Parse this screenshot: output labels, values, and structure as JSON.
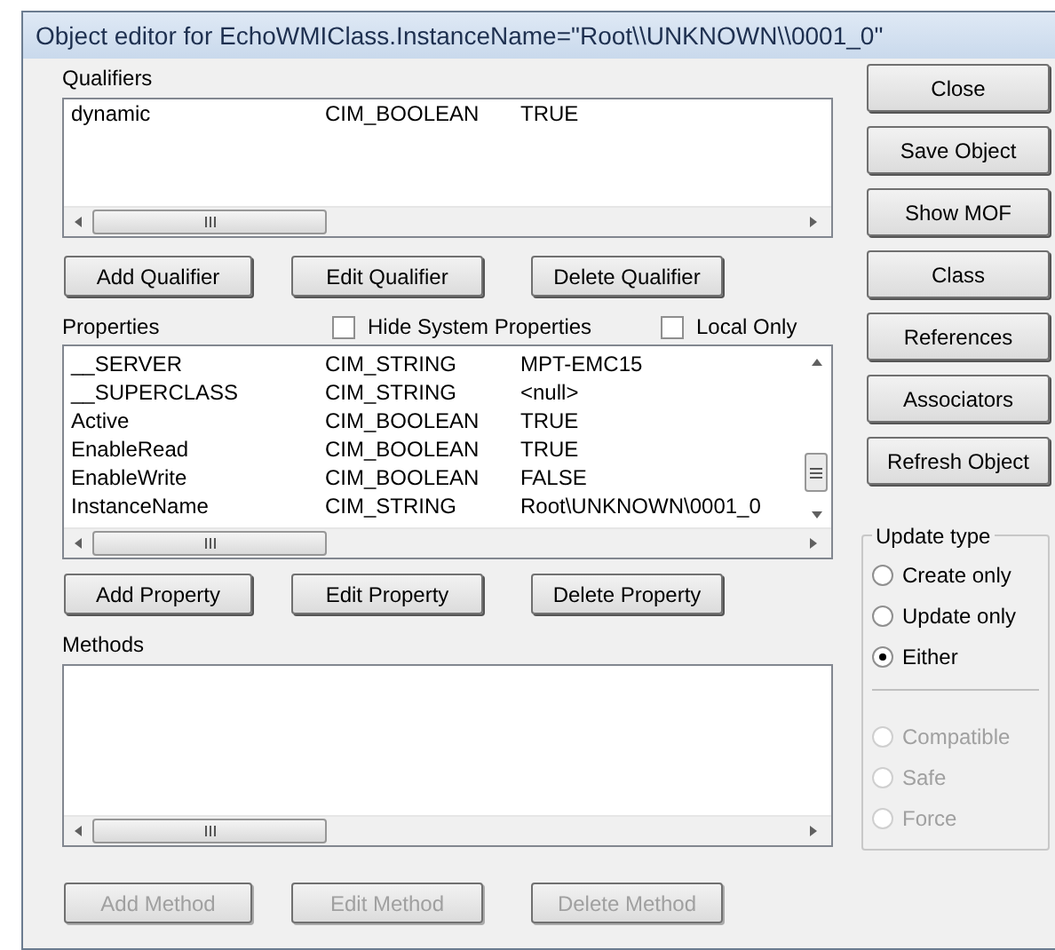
{
  "window": {
    "title": "Object editor for EchoWMIClass.InstanceName=\"Root\\\\UNKNOWN\\\\0001_0\""
  },
  "qualifiers": {
    "label": "Qualifiers",
    "rows": [
      {
        "name": "dynamic",
        "type": "CIM_BOOLEAN",
        "value": "TRUE"
      }
    ],
    "buttons": [
      {
        "label": "Add Qualifier",
        "disabled": false
      },
      {
        "label": "Edit Qualifier",
        "disabled": false
      },
      {
        "label": "Delete Qualifier",
        "disabled": false
      }
    ]
  },
  "properties": {
    "label": "Properties",
    "options": [
      {
        "label": "Hide System Properties",
        "checked": false
      },
      {
        "label": "Local Only",
        "checked": false
      }
    ],
    "rows": [
      {
        "name": "__SERVER",
        "type": "CIM_STRING",
        "value": "MPT-EMC15"
      },
      {
        "name": "__SUPERCLASS",
        "type": "CIM_STRING",
        "value": "<null>"
      },
      {
        "name": "Active",
        "type": "CIM_BOOLEAN",
        "value": "TRUE"
      },
      {
        "name": "EnableRead",
        "type": "CIM_BOOLEAN",
        "value": "TRUE"
      },
      {
        "name": "EnableWrite",
        "type": "CIM_BOOLEAN",
        "value": "FALSE"
      },
      {
        "name": "InstanceName",
        "type": "CIM_STRING",
        "value": "Root\\UNKNOWN\\0001_0"
      }
    ],
    "buttons": [
      {
        "label": "Add Property",
        "disabled": false
      },
      {
        "label": "Edit Property",
        "disabled": false
      },
      {
        "label": "Delete Property",
        "disabled": false
      }
    ]
  },
  "methods": {
    "label": "Methods",
    "buttons": [
      {
        "label": "Add Method",
        "disabled": true
      },
      {
        "label": "Edit Method",
        "disabled": true
      },
      {
        "label": "Delete Method",
        "disabled": true
      }
    ]
  },
  "side_buttons": [
    "Close",
    "Save Object",
    "Show MOF",
    "Class",
    "References",
    "Associators",
    "Refresh Object"
  ],
  "update_type": {
    "label": "Update type",
    "options": [
      {
        "label": "Create only",
        "selected": false,
        "disabled": false
      },
      {
        "label": "Update only",
        "selected": false,
        "disabled": false
      },
      {
        "label": "Either",
        "selected": true,
        "disabled": false
      },
      {
        "kind": "separator"
      },
      {
        "label": "Compatible",
        "selected": false,
        "disabled": true
      },
      {
        "label": "Safe",
        "selected": false,
        "disabled": true
      },
      {
        "label": "Force",
        "selected": false,
        "disabled": true
      }
    ]
  }
}
